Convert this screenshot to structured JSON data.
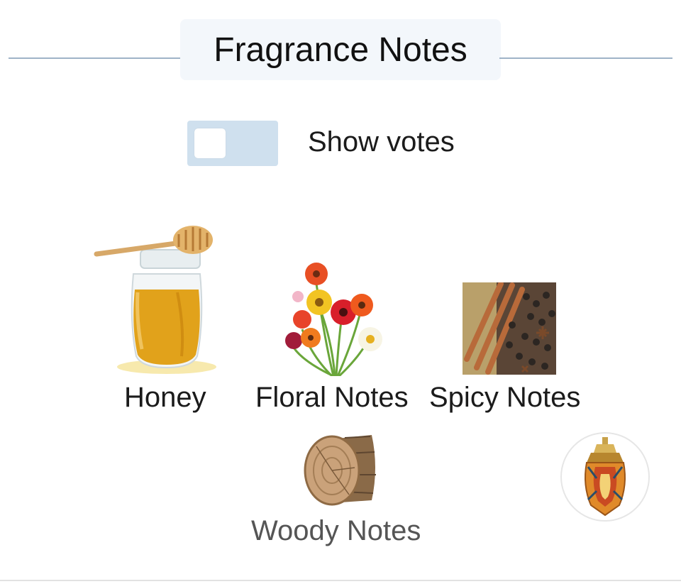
{
  "section": {
    "title": "Fragrance Notes"
  },
  "toggle": {
    "label": "Show votes",
    "checked": false
  },
  "notes": [
    {
      "name": "Honey",
      "icon": "honey-jar-icon"
    },
    {
      "name": "Floral Notes",
      "icon": "flowers-icon"
    },
    {
      "name": "Spicy Notes",
      "icon": "spices-icon"
    },
    {
      "name": "Woody Notes",
      "icon": "wood-log-icon"
    }
  ],
  "badge": {
    "icon": "perfume-bottle-icon"
  },
  "colors": {
    "divider": "#9fb3c8",
    "header_bg": "#f3f7fb",
    "toggle_track": "#cfe0ee"
  }
}
